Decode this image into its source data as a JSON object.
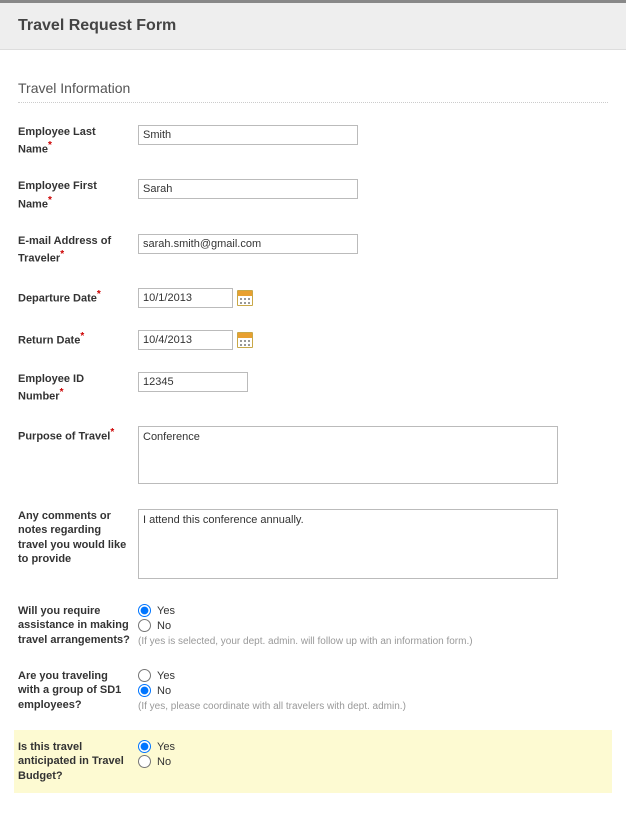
{
  "header": {
    "title": "Travel Request Form"
  },
  "section": {
    "title": "Travel Information"
  },
  "fields": {
    "lastName": {
      "label": "Employee Last Name",
      "value": "Smith"
    },
    "firstName": {
      "label": "Employee First Name",
      "value": "Sarah"
    },
    "email": {
      "label": "E-mail Address of Traveler",
      "value": "sarah.smith@gmail.com"
    },
    "departure": {
      "label": "Departure Date",
      "value": "10/1/2013"
    },
    "return": {
      "label": "Return Date",
      "value": "10/4/2013"
    },
    "empId": {
      "label": "Employee ID Number",
      "value": "12345"
    },
    "purpose": {
      "label": "Purpose of Travel",
      "value": "Conference"
    },
    "comments": {
      "label": "Any comments or notes regarding travel you would like to provide",
      "value": "I attend this conference annually."
    },
    "assistance": {
      "label": "Will you require assistance in making travel arrangements?",
      "optYes": "Yes",
      "optNo": "No",
      "hint": "(If yes is selected, your dept. admin. will follow up with an information form.)",
      "selected": "yes"
    },
    "group": {
      "label": "Are you traveling with a group of SD1 employees?",
      "optYes": "Yes",
      "optNo": "No",
      "hint": "(If yes, please coordinate with all travelers with dept. admin.)",
      "selected": "no"
    },
    "budget": {
      "label": "Is this travel anticipated in Travel Budget?",
      "optYes": "Yes",
      "optNo": "No",
      "selected": "yes"
    }
  }
}
